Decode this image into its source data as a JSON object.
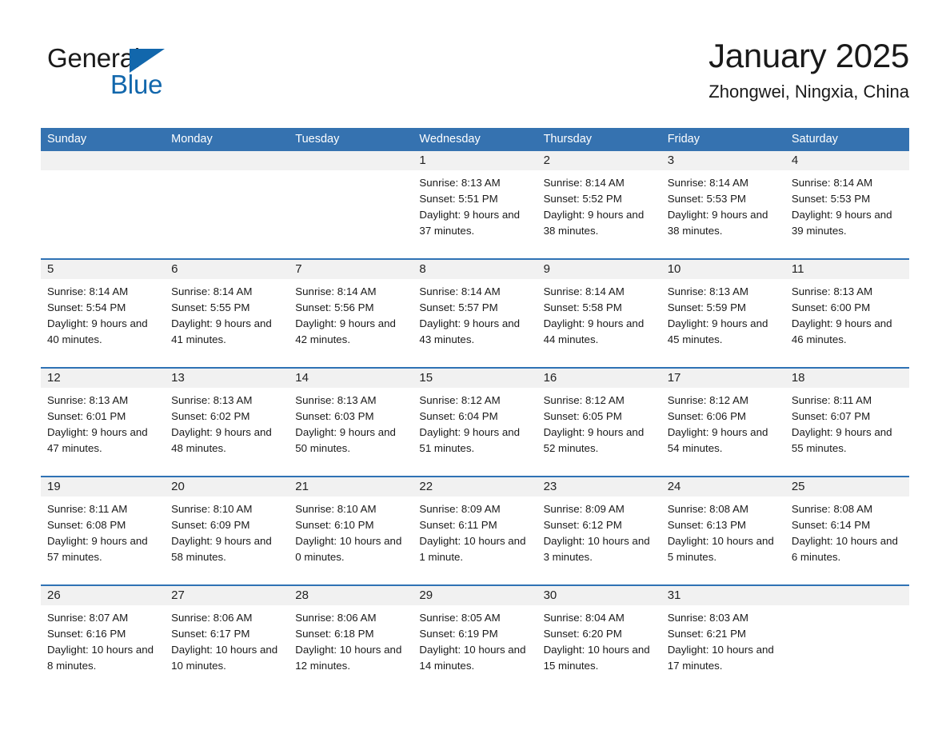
{
  "brand": {
    "name_part1": "General",
    "name_part2": "Blue",
    "triangle_color": "#1267ac"
  },
  "header": {
    "title": "January 2025",
    "subtitle": "Zhongwei, Ningxia, China"
  },
  "theme": {
    "header_blue": "#3572b0",
    "row_divider_blue": "#2f72b5",
    "daynum_band": "#f1f1f1",
    "text": "#1a1a1a"
  },
  "weekday_headers": [
    "Sunday",
    "Monday",
    "Tuesday",
    "Wednesday",
    "Thursday",
    "Friday",
    "Saturday"
  ],
  "weeks": [
    [
      {
        "day": "",
        "sunrise": "",
        "sunset": "",
        "daylight": ""
      },
      {
        "day": "",
        "sunrise": "",
        "sunset": "",
        "daylight": ""
      },
      {
        "day": "",
        "sunrise": "",
        "sunset": "",
        "daylight": ""
      },
      {
        "day": "1",
        "sunrise": "Sunrise: 8:13 AM",
        "sunset": "Sunset: 5:51 PM",
        "daylight": "Daylight: 9 hours and 37 minutes."
      },
      {
        "day": "2",
        "sunrise": "Sunrise: 8:14 AM",
        "sunset": "Sunset: 5:52 PM",
        "daylight": "Daylight: 9 hours and 38 minutes."
      },
      {
        "day": "3",
        "sunrise": "Sunrise: 8:14 AM",
        "sunset": "Sunset: 5:53 PM",
        "daylight": "Daylight: 9 hours and 38 minutes."
      },
      {
        "day": "4",
        "sunrise": "Sunrise: 8:14 AM",
        "sunset": "Sunset: 5:53 PM",
        "daylight": "Daylight: 9 hours and 39 minutes."
      }
    ],
    [
      {
        "day": "5",
        "sunrise": "Sunrise: 8:14 AM",
        "sunset": "Sunset: 5:54 PM",
        "daylight": "Daylight: 9 hours and 40 minutes."
      },
      {
        "day": "6",
        "sunrise": "Sunrise: 8:14 AM",
        "sunset": "Sunset: 5:55 PM",
        "daylight": "Daylight: 9 hours and 41 minutes."
      },
      {
        "day": "7",
        "sunrise": "Sunrise: 8:14 AM",
        "sunset": "Sunset: 5:56 PM",
        "daylight": "Daylight: 9 hours and 42 minutes."
      },
      {
        "day": "8",
        "sunrise": "Sunrise: 8:14 AM",
        "sunset": "Sunset: 5:57 PM",
        "daylight": "Daylight: 9 hours and 43 minutes."
      },
      {
        "day": "9",
        "sunrise": "Sunrise: 8:14 AM",
        "sunset": "Sunset: 5:58 PM",
        "daylight": "Daylight: 9 hours and 44 minutes."
      },
      {
        "day": "10",
        "sunrise": "Sunrise: 8:13 AM",
        "sunset": "Sunset: 5:59 PM",
        "daylight": "Daylight: 9 hours and 45 minutes."
      },
      {
        "day": "11",
        "sunrise": "Sunrise: 8:13 AM",
        "sunset": "Sunset: 6:00 PM",
        "daylight": "Daylight: 9 hours and 46 minutes."
      }
    ],
    [
      {
        "day": "12",
        "sunrise": "Sunrise: 8:13 AM",
        "sunset": "Sunset: 6:01 PM",
        "daylight": "Daylight: 9 hours and 47 minutes."
      },
      {
        "day": "13",
        "sunrise": "Sunrise: 8:13 AM",
        "sunset": "Sunset: 6:02 PM",
        "daylight": "Daylight: 9 hours and 48 minutes."
      },
      {
        "day": "14",
        "sunrise": "Sunrise: 8:13 AM",
        "sunset": "Sunset: 6:03 PM",
        "daylight": "Daylight: 9 hours and 50 minutes."
      },
      {
        "day": "15",
        "sunrise": "Sunrise: 8:12 AM",
        "sunset": "Sunset: 6:04 PM",
        "daylight": "Daylight: 9 hours and 51 minutes."
      },
      {
        "day": "16",
        "sunrise": "Sunrise: 8:12 AM",
        "sunset": "Sunset: 6:05 PM",
        "daylight": "Daylight: 9 hours and 52 minutes."
      },
      {
        "day": "17",
        "sunrise": "Sunrise: 8:12 AM",
        "sunset": "Sunset: 6:06 PM",
        "daylight": "Daylight: 9 hours and 54 minutes."
      },
      {
        "day": "18",
        "sunrise": "Sunrise: 8:11 AM",
        "sunset": "Sunset: 6:07 PM",
        "daylight": "Daylight: 9 hours and 55 minutes."
      }
    ],
    [
      {
        "day": "19",
        "sunrise": "Sunrise: 8:11 AM",
        "sunset": "Sunset: 6:08 PM",
        "daylight": "Daylight: 9 hours and 57 minutes."
      },
      {
        "day": "20",
        "sunrise": "Sunrise: 8:10 AM",
        "sunset": "Sunset: 6:09 PM",
        "daylight": "Daylight: 9 hours and 58 minutes."
      },
      {
        "day": "21",
        "sunrise": "Sunrise: 8:10 AM",
        "sunset": "Sunset: 6:10 PM",
        "daylight": "Daylight: 10 hours and 0 minutes."
      },
      {
        "day": "22",
        "sunrise": "Sunrise: 8:09 AM",
        "sunset": "Sunset: 6:11 PM",
        "daylight": "Daylight: 10 hours and 1 minute."
      },
      {
        "day": "23",
        "sunrise": "Sunrise: 8:09 AM",
        "sunset": "Sunset: 6:12 PM",
        "daylight": "Daylight: 10 hours and 3 minutes."
      },
      {
        "day": "24",
        "sunrise": "Sunrise: 8:08 AM",
        "sunset": "Sunset: 6:13 PM",
        "daylight": "Daylight: 10 hours and 5 minutes."
      },
      {
        "day": "25",
        "sunrise": "Sunrise: 8:08 AM",
        "sunset": "Sunset: 6:14 PM",
        "daylight": "Daylight: 10 hours and 6 minutes."
      }
    ],
    [
      {
        "day": "26",
        "sunrise": "Sunrise: 8:07 AM",
        "sunset": "Sunset: 6:16 PM",
        "daylight": "Daylight: 10 hours and 8 minutes."
      },
      {
        "day": "27",
        "sunrise": "Sunrise: 8:06 AM",
        "sunset": "Sunset: 6:17 PM",
        "daylight": "Daylight: 10 hours and 10 minutes."
      },
      {
        "day": "28",
        "sunrise": "Sunrise: 8:06 AM",
        "sunset": "Sunset: 6:18 PM",
        "daylight": "Daylight: 10 hours and 12 minutes."
      },
      {
        "day": "29",
        "sunrise": "Sunrise: 8:05 AM",
        "sunset": "Sunset: 6:19 PM",
        "daylight": "Daylight: 10 hours and 14 minutes."
      },
      {
        "day": "30",
        "sunrise": "Sunrise: 8:04 AM",
        "sunset": "Sunset: 6:20 PM",
        "daylight": "Daylight: 10 hours and 15 minutes."
      },
      {
        "day": "31",
        "sunrise": "Sunrise: 8:03 AM",
        "sunset": "Sunset: 6:21 PM",
        "daylight": "Daylight: 10 hours and 17 minutes."
      },
      {
        "day": "",
        "sunrise": "",
        "sunset": "",
        "daylight": ""
      }
    ]
  ]
}
